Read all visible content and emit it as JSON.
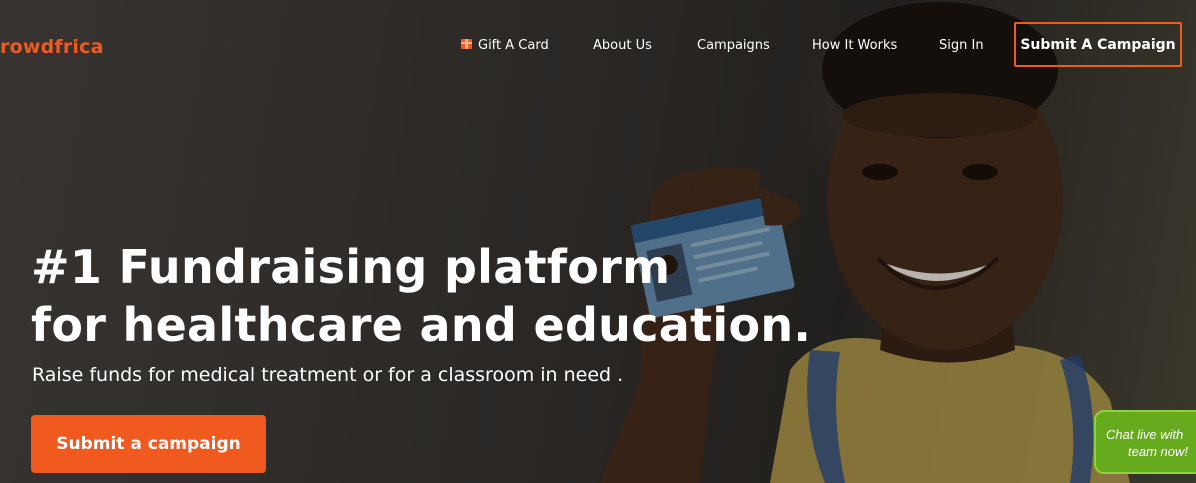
{
  "brand": {
    "logo_text": "rowdfrica",
    "accent_color": "#f05a1e"
  },
  "nav": {
    "items": [
      {
        "label": "Gift A Card",
        "icon": "gift-icon"
      },
      {
        "label": "About Us"
      },
      {
        "label": "Campaigns"
      },
      {
        "label": "How It Works"
      },
      {
        "label": "Sign In"
      }
    ],
    "cta_label": "Submit A Campaign"
  },
  "hero": {
    "headline_line1": "#1 Fundraising platform",
    "headline_line2": "for healthcare and education.",
    "subheadline": "Raise funds for medical treatment or for a classroom in need .",
    "cta_label": "Submit a campaign"
  },
  "chat_widget": {
    "line1": "Chat live with",
    "line2": "team now!",
    "color": "#66aa1e"
  }
}
